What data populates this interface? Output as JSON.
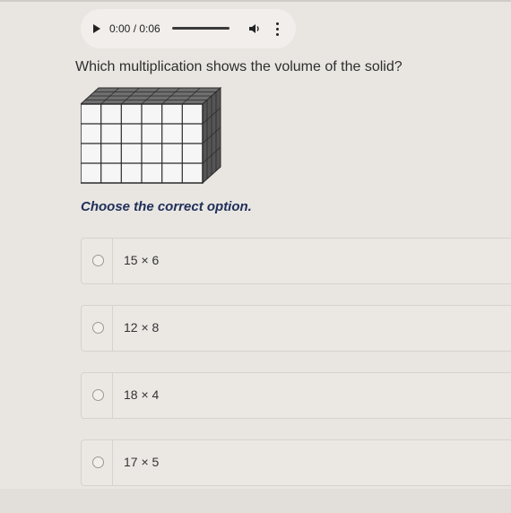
{
  "audio": {
    "time": "0:00 / 0:06",
    "progress": 0
  },
  "question": "Which multiplication shows the volume of the solid?",
  "prompt": "Choose the correct option.",
  "options": [
    {
      "label": "15 × 6"
    },
    {
      "label": "12 × 8"
    },
    {
      "label": "18 × 4"
    },
    {
      "label": "17 × 5"
    }
  ]
}
